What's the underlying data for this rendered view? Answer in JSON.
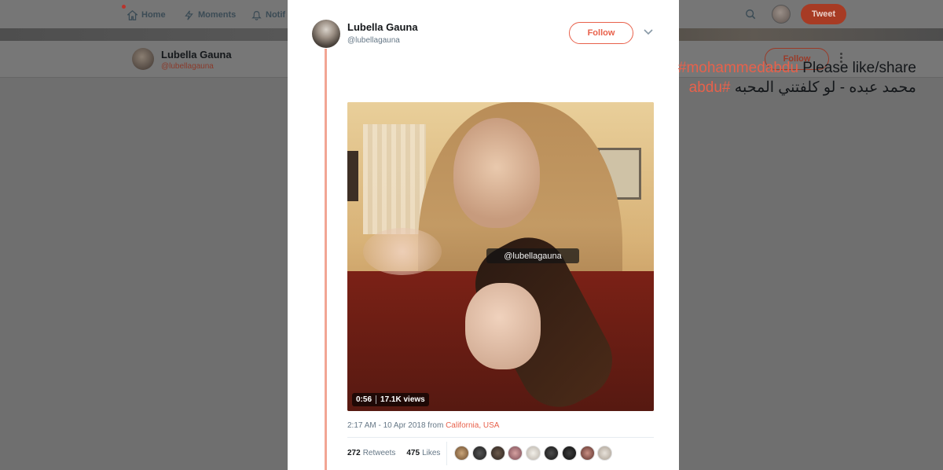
{
  "background": {
    "nav": {
      "home": "Home",
      "moments": "Moments",
      "notifications": "Notif",
      "tweet_button": "Tweet"
    },
    "profile": {
      "name": "Lubella Gauna",
      "handle": "@lubellagauna",
      "follow_label": "Follow"
    }
  },
  "tweet": {
    "author_name": "Lubella Gauna",
    "author_handle": "@lubellagauna",
    "follow_label": "Follow",
    "hashtag1": "#mohammedabdu",
    "text1": " Please like/share",
    "arabic_text": "محمد عبده - لو كلفتني المحبه ",
    "hashtag2": "#abdu",
    "video": {
      "watermark": "@lubellagauna",
      "duration": "0:56",
      "views": "17.1K views"
    },
    "timestamp": "2:17 AM - 10 Apr 2018 from ",
    "location": "California, USA",
    "retweets_count": "272",
    "retweets_label": "Retweets",
    "likes_count": "475",
    "likes_label": "Likes"
  },
  "colors": {
    "accent": "#e8614b",
    "text": "#14171a",
    "muted": "#657786",
    "overlay_bg": "#6f6f6f"
  },
  "icons": [
    "home-icon",
    "moments-icon",
    "notifications-icon",
    "search-icon",
    "chevron-down-icon",
    "more-icon"
  ]
}
